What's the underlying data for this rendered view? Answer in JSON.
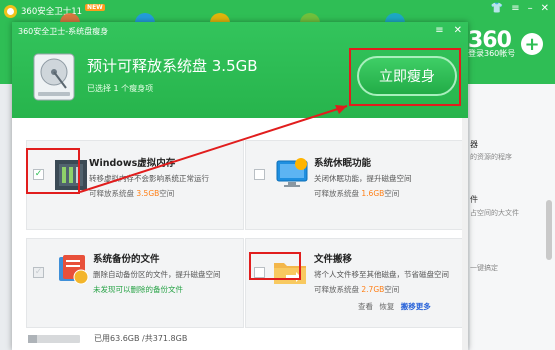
{
  "background_app": {
    "title": "360安全卫士11",
    "badge": "NEW",
    "ctrl_icons": [
      "shirt-icon",
      "menu-icon",
      "minimize-icon",
      "close-icon"
    ],
    "brand": "360",
    "login_text": "登录360帐号",
    "plus": "+",
    "right_items": [
      {
        "title": "器",
        "sub": "的资源的程序"
      },
      {
        "title": "件",
        "sub": "占空间的大文件"
      },
      {
        "title": "",
        "sub": "一键搞定"
      }
    ],
    "colors": {
      "header": "#2fbe55"
    }
  },
  "dialog": {
    "title": "360安全卫士-系统盘瘦身",
    "ctrl_icons": [
      "menu-icon",
      "close-icon"
    ],
    "headline": "预计可释放系统盘 3.5GB",
    "selected_text": "已选择 1 个瘦身项",
    "slim_button": "立即瘦身",
    "cards": [
      {
        "title": "Windows虚拟内存",
        "desc": "转移虚拟内存不会影响系统正常运行",
        "info_prefix": "可释放系统盘",
        "info_value": "3.5GB",
        "info_suffix": "空间",
        "checked": true,
        "icon": "memory-chip-icon"
      },
      {
        "title": "系统休眠功能",
        "desc": "关闭休眠功能，提升磁盘空间",
        "info_prefix": "可释放系统盘",
        "info_value": "1.6GB",
        "info_suffix": "空间",
        "checked": false,
        "icon": "sleep-monitor-icon"
      },
      {
        "title": "系统备份的文件",
        "desc": "删除自动备份区的文件，提升磁盘空间",
        "info_text": "未发现可以删除的备份文件",
        "checked": false,
        "disabled": true,
        "icon": "backup-files-icon"
      },
      {
        "title": "文件搬移",
        "desc": "将个人文件移至其他磁盘，节省磁盘空间",
        "info_prefix": "可释放系统盘",
        "info_value": "2.7GB",
        "info_suffix": "空间",
        "checked": false,
        "icon": "folder-move-icon",
        "links": [
          "查看",
          "恢复",
          "搬移更多"
        ]
      }
    ],
    "footer": {
      "disk_text": "已用63.6GB /共371.8GB",
      "used_fraction": 0.171
    },
    "colors": {
      "accent": "#2fbe55",
      "highlight": "#ff7f16",
      "annotation": "#e11d1d"
    }
  }
}
